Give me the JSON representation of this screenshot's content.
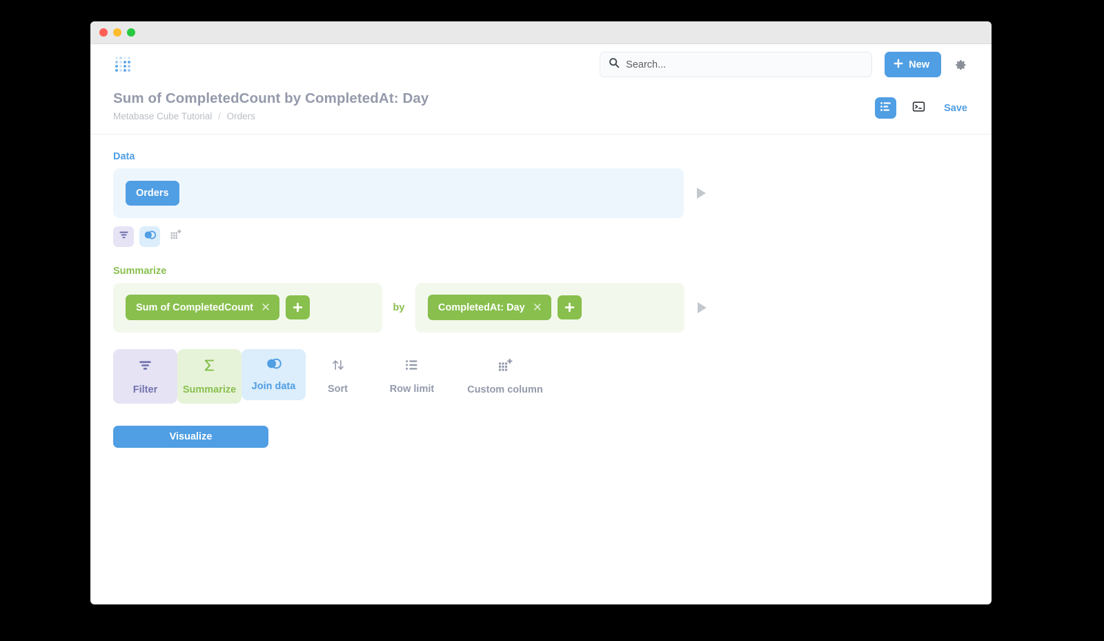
{
  "window": {
    "traffic_lights": [
      "close",
      "minimize",
      "maximize"
    ]
  },
  "appbar": {
    "logo": "metabase-logo",
    "search": {
      "icon": "search-icon",
      "placeholder": "Search...",
      "value": ""
    },
    "new_button": {
      "label": "New",
      "icon": "plus-icon"
    },
    "settings": {
      "icon": "gear-icon"
    },
    "accent_color": "#509ee3"
  },
  "question_header": {
    "title": "Sum of CompletedCount by CompletedAt: Day",
    "breadcrumb": {
      "collection": "Metabase Cube Tutorial",
      "separator": "/",
      "table": "Orders"
    },
    "actions": {
      "notebook_toggle": {
        "icon": "notebook-icon",
        "active": true
      },
      "native_query_toggle": {
        "icon": "console-icon",
        "active": false
      },
      "save_label": "Save"
    }
  },
  "notebook": {
    "data_step": {
      "label": "Data",
      "label_color": "#509ee3",
      "source_table": "Orders",
      "preview_icon": "play-icon",
      "mini_actions": [
        {
          "name": "filter",
          "icon": "filter-icon",
          "bg": "#e6e3f5"
        },
        {
          "name": "join",
          "icon": "join-icon",
          "bg": "#dcedfb"
        },
        {
          "name": "custom-column",
          "icon": "custom-column-icon",
          "bg": "transparent"
        }
      ]
    },
    "summarize_step": {
      "label": "Summarize",
      "label_color": "#88bf4d",
      "aggregation": "Sum of CompletedCount",
      "aggregation_remove": "✕",
      "aggregation_add": "+",
      "by_label": "by",
      "breakout": "CompletedAt: Day",
      "breakout_remove": "✕",
      "breakout_add": "+",
      "preview_icon": "play-icon"
    },
    "action_buttons": [
      {
        "label": "Filter",
        "icon": "filter-icon",
        "style": "filter"
      },
      {
        "label": "Summarize",
        "icon": "sigma-icon",
        "style": "summarize"
      },
      {
        "label": "Join data",
        "icon": "join-icon",
        "style": "join"
      },
      {
        "label": "Sort",
        "icon": "sort-icon",
        "style": "plain"
      },
      {
        "label": "Row limit",
        "icon": "row-limit-icon",
        "style": "plain"
      },
      {
        "label": "Custom column",
        "icon": "custom-column-icon",
        "style": "plain"
      }
    ],
    "visualize_button": {
      "label": "Visualize",
      "color": "#509ee3"
    }
  }
}
